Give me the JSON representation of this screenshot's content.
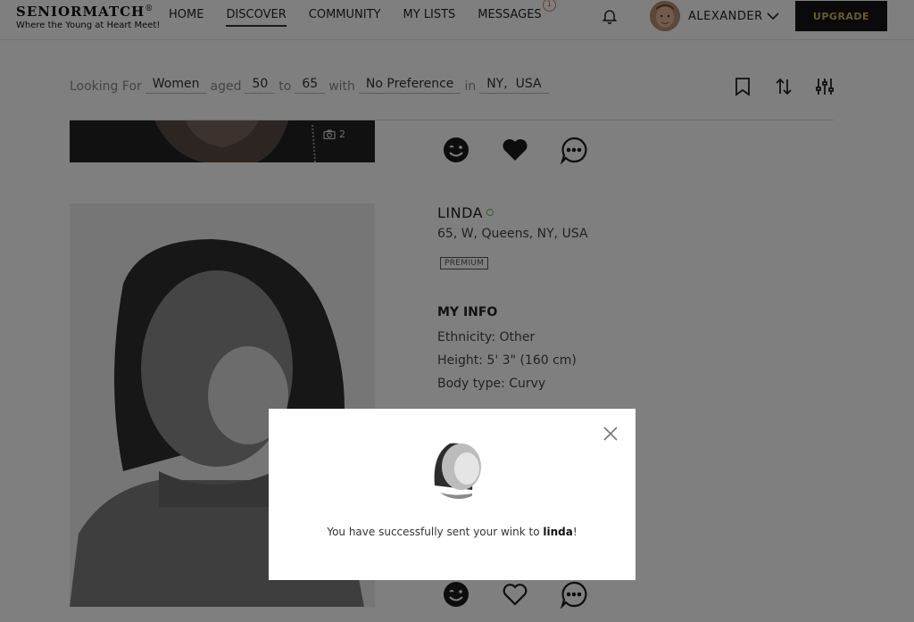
{
  "brand": {
    "name": "SENIORMATCH",
    "reg": "®",
    "tagline": "Where the Young at Heart Meet!"
  },
  "nav": {
    "items": [
      {
        "label": "HOME"
      },
      {
        "label": "DISCOVER",
        "active": true
      },
      {
        "label": "COMMUNITY"
      },
      {
        "label": "MY LISTS"
      },
      {
        "label": "MESSAGES",
        "badge": "1"
      }
    ]
  },
  "user": {
    "name": "ALEXANDER",
    "upgrade_label": "UPGRADE"
  },
  "filters": {
    "looking_for_label": "Looking For",
    "looking_for": "Women",
    "aged_label": "aged",
    "age_min": "50",
    "to_label": "to",
    "age_max": "65",
    "with_label": "with",
    "preference": "No Preference",
    "in_label": "in",
    "location": "NY,  USA"
  },
  "prev_card": {
    "photo_count": "2"
  },
  "profile": {
    "name": "LINDA",
    "location": "65, W, Queens, NY, USA",
    "badge": "PREMIUM",
    "info_title": "MY INFO",
    "info": [
      "Ethnicity: Other",
      "Height: 5' 3\" (160 cm)",
      "Body type: Curvy"
    ]
  },
  "modal": {
    "message_prefix": "You have successfully sent your wink to ",
    "recipient": "linda",
    "message_suffix": "!"
  },
  "colors": {
    "accent": "#d9b25a",
    "badge": "#d27a52",
    "online": "#6cbf6c",
    "overlay": "rgba(0,0,0,0.5)"
  },
  "icons": [
    "bell-icon",
    "chevron-down-icon",
    "bookmark-icon",
    "sort-icon",
    "filter-sliders-icon",
    "camera-icon",
    "wink-icon",
    "heart-icon",
    "chat-icon",
    "close-icon"
  ]
}
